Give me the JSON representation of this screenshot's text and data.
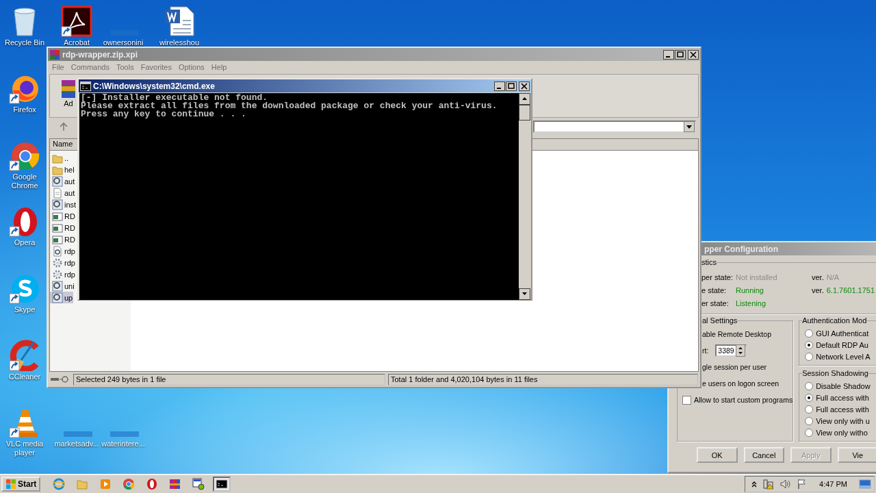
{
  "desktop": {
    "icons": [
      {
        "label": "Recycle Bin",
        "kind": "recycle"
      },
      {
        "label": "Acrobat",
        "kind": "acrobat"
      },
      {
        "label": "ownersonini",
        "kind": "blank"
      },
      {
        "label": "wirelesshou",
        "kind": "word"
      },
      {
        "label": "Firefox",
        "kind": "firefox"
      },
      {
        "label": "Google Chrome",
        "kind": "chrome"
      },
      {
        "label": "Opera",
        "kind": "opera"
      },
      {
        "label": "Skype",
        "kind": "skype"
      },
      {
        "label": "CCleaner",
        "kind": "ccleaner"
      },
      {
        "label": "VLC media player",
        "kind": "vlc"
      },
      {
        "label": "marketsadv...",
        "kind": "blank"
      },
      {
        "label": "waterintere...",
        "kind": "blank"
      }
    ]
  },
  "archiver_window": {
    "title": "rdp-wrapper.zip.xpi",
    "menu": [
      "File",
      "Commands",
      "Tools",
      "Favorites",
      "Options",
      "Help"
    ],
    "toolbar_label": "Ad",
    "column": "Name",
    "files": [
      {
        "name": "..",
        "kind": "folder",
        "selected": false
      },
      {
        "name": "hel",
        "kind": "folder",
        "selected": false
      },
      {
        "name": "aut",
        "kind": "setup",
        "selected": false
      },
      {
        "name": "aut",
        "kind": "text",
        "selected": false
      },
      {
        "name": "inst",
        "kind": "setup",
        "selected": false
      },
      {
        "name": "RD",
        "kind": "app",
        "selected": false
      },
      {
        "name": "RD",
        "kind": "app",
        "selected": false
      },
      {
        "name": "RD",
        "kind": "app",
        "selected": false
      },
      {
        "name": "rdp",
        "kind": "config",
        "selected": false
      },
      {
        "name": "rdp",
        "kind": "gear",
        "selected": false
      },
      {
        "name": "rdp",
        "kind": "gear",
        "selected": false
      },
      {
        "name": "uni",
        "kind": "setup",
        "selected": false
      },
      {
        "name": "up",
        "kind": "setup",
        "selected": true
      }
    ],
    "status_left": "Selected 249 bytes in 1 file",
    "status_right": "Total 1 folder and 4,020,104 bytes in 11 files"
  },
  "console_window": {
    "title": "C:\\Windows\\system32\\cmd.exe",
    "lines": [
      "[-] Installer executable not found.",
      "Please extract all files from the downloaded package or check your anti-virus.",
      "Press any key to continue . . ."
    ]
  },
  "config_window": {
    "title": "pper Configuration",
    "diagnostics": {
      "title": "stics",
      "rows": [
        {
          "label": "per state:",
          "value": "Not installed",
          "color": "#8c8c8c",
          "version_label": "ver.",
          "version": "N/A"
        },
        {
          "label": "e state:",
          "value": "Running",
          "color": "#0a8a0a",
          "version_label": "ver.",
          "version": "6.1.7601.1751"
        },
        {
          "label": "er state:",
          "value": "Listening",
          "color": "#0a8a0a"
        }
      ]
    },
    "general": {
      "title": "al Settings",
      "items": [
        {
          "kind": "text",
          "label": "able Remote Desktop"
        },
        {
          "kind": "spin",
          "label": "rt:",
          "value": "3389"
        },
        {
          "kind": "text",
          "label": "gle session per user"
        },
        {
          "kind": "text",
          "label": "e users on logon screen"
        },
        {
          "kind": "checkbox",
          "label": "Allow to start custom programs",
          "checked": false
        }
      ]
    },
    "authentication": {
      "title": "Authentication Mod",
      "options": [
        {
          "label": "GUI Authenticat",
          "selected": false
        },
        {
          "label": "Default RDP Au",
          "selected": true
        },
        {
          "label": "Network Level A",
          "selected": false
        }
      ]
    },
    "shadowing": {
      "title": "Session Shadowing",
      "options": [
        {
          "label": "Disable Shadow",
          "selected": false
        },
        {
          "label": "Full access with",
          "selected": true
        },
        {
          "label": "Full access with",
          "selected": false
        },
        {
          "label": "View only with u",
          "selected": false
        },
        {
          "label": "View only witho",
          "selected": false
        }
      ]
    },
    "buttons": [
      {
        "label": "OK",
        "disabled": false
      },
      {
        "label": "Cancel",
        "disabled": false
      },
      {
        "label": "Apply",
        "disabled": true
      },
      {
        "label": "Vie",
        "disabled": false
      }
    ]
  },
  "taskbar": {
    "start": "Start",
    "apps": [
      {
        "kind": "ie",
        "active": false
      },
      {
        "kind": "explorer",
        "active": false
      },
      {
        "kind": "media",
        "active": false
      },
      {
        "kind": "chrome",
        "active": false
      },
      {
        "kind": "opera",
        "active": false
      },
      {
        "kind": "winrar",
        "active": false
      },
      {
        "kind": "rdpconf",
        "active": false
      },
      {
        "kind": "cmd",
        "active": true
      }
    ],
    "time": "4:47 PM"
  }
}
